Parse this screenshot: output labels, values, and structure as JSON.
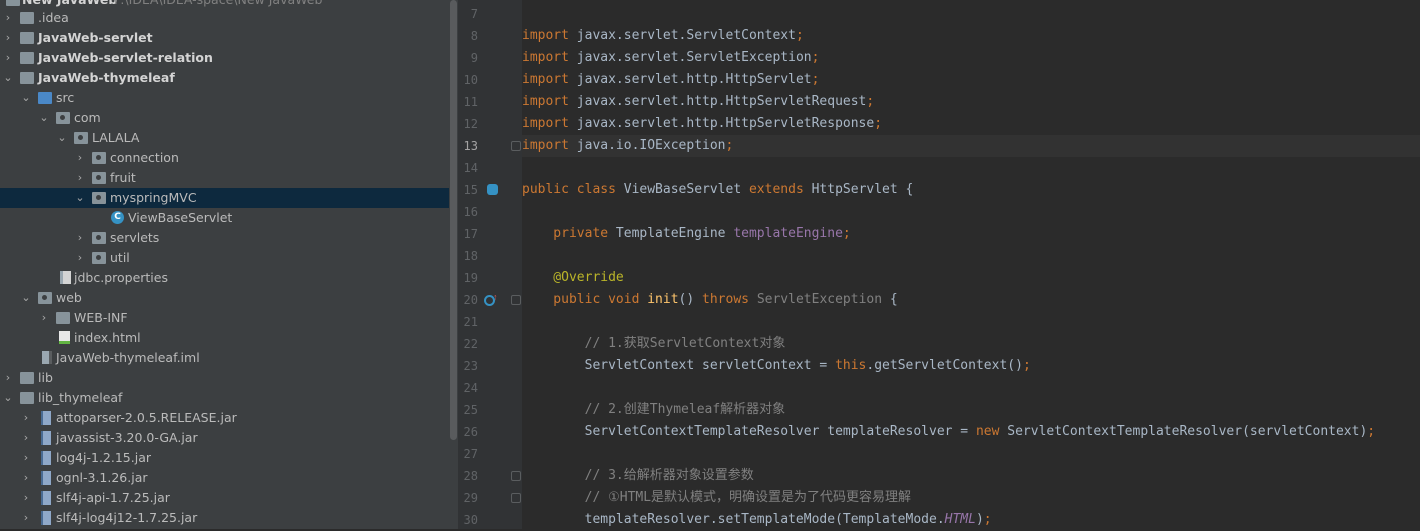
{
  "project_tree": {
    "root_label": "New JavaWeb",
    "root_path": "F:\\IDEA\\IDEA-space\\New JavaWeb",
    "items": [
      {
        "label": ".idea"
      },
      {
        "label": "JavaWeb-servlet"
      },
      {
        "label": "JavaWeb-servlet-relation"
      },
      {
        "label": "JavaWeb-thymeleaf"
      },
      {
        "label": "src"
      },
      {
        "label": "com"
      },
      {
        "label": "LALALA"
      },
      {
        "label": "connection"
      },
      {
        "label": "fruit"
      },
      {
        "label": "myspringMVC"
      },
      {
        "label": "ViewBaseServlet"
      },
      {
        "label": "servlets"
      },
      {
        "label": "util"
      },
      {
        "label": "jdbc.properties"
      },
      {
        "label": "web"
      },
      {
        "label": "WEB-INF"
      },
      {
        "label": "index.html"
      },
      {
        "label": "JavaWeb-thymeleaf.iml"
      },
      {
        "label": "lib"
      },
      {
        "label": "lib_thymeleaf"
      },
      {
        "label": "attoparser-2.0.5.RELEASE.jar"
      },
      {
        "label": "javassist-3.20.0-GA.jar"
      },
      {
        "label": "log4j-1.2.15.jar"
      },
      {
        "label": "ognl-3.1.26.jar"
      },
      {
        "label": "slf4j-api-1.7.25.jar"
      },
      {
        "label": "slf4j-log4j12-1.7.25.jar"
      }
    ]
  },
  "editor": {
    "current_line": "13",
    "lines": [
      {
        "n": "7",
        "t": ""
      },
      {
        "n": "8",
        "p": [
          "import",
          " javax.servlet.ServletContext",
          ";"
        ]
      },
      {
        "n": "9",
        "p": [
          "import",
          " javax.servlet.ServletException",
          ";"
        ]
      },
      {
        "n": "10",
        "p": [
          "import",
          " javax.servlet.http.HttpServlet",
          ";"
        ]
      },
      {
        "n": "11",
        "p": [
          "import",
          " javax.servlet.http.HttpServletRequest",
          ";"
        ]
      },
      {
        "n": "12",
        "p": [
          "import",
          " javax.servlet.http.HttpServletResponse",
          ";"
        ]
      },
      {
        "n": "13",
        "p": [
          "import",
          " java.io.IOException",
          ";"
        ]
      },
      {
        "n": "14",
        "t": ""
      },
      {
        "n": "15",
        "p": [
          "public class",
          " ViewBaseServlet ",
          "extends",
          " HttpServlet {"
        ]
      },
      {
        "n": "16",
        "t": ""
      },
      {
        "n": "17",
        "p": [
          "    private",
          " TemplateEngine ",
          "templateEngine",
          ";"
        ]
      },
      {
        "n": "18",
        "t": ""
      },
      {
        "n": "19",
        "p": [
          "    @Override"
        ]
      },
      {
        "n": "20",
        "p": [
          "    public void",
          " ",
          "init",
          "() ",
          "throws",
          " ",
          "ServletException",
          " {"
        ]
      },
      {
        "n": "21",
        "t": ""
      },
      {
        "n": "22",
        "p": [
          "        // 1.获取ServletContext对象"
        ]
      },
      {
        "n": "23",
        "p": [
          "        ServletContext servletContext = ",
          "this",
          ".getServletContext()",
          ";"
        ]
      },
      {
        "n": "24",
        "t": ""
      },
      {
        "n": "25",
        "p": [
          "        // 2.创建Thymeleaf解析器对象"
        ]
      },
      {
        "n": "26",
        "p": [
          "        ServletContextTemplateResolver templateResolver = ",
          "new",
          " ServletContextTemplateResolver(servletContext)",
          ";"
        ]
      },
      {
        "n": "27",
        "t": ""
      },
      {
        "n": "28",
        "p": [
          "        // 3.给解析器对象设置参数"
        ]
      },
      {
        "n": "29",
        "p": [
          "        // ①HTML是默认模式，明确设置是为了代码更容易理解"
        ]
      },
      {
        "n": "30",
        "p": [
          "        templateResolver.setTemplateMode(TemplateMode.",
          "HTML",
          ")",
          ";"
        ]
      }
    ]
  },
  "colors": {
    "tree_bg": "#3c3f41",
    "selection": "#0d293e",
    "editor_bg": "#2b2b2b",
    "keyword": "#cc7832",
    "comment": "#808080",
    "annotation": "#bbb529",
    "field": "#9876aa",
    "method": "#ffc66d"
  }
}
